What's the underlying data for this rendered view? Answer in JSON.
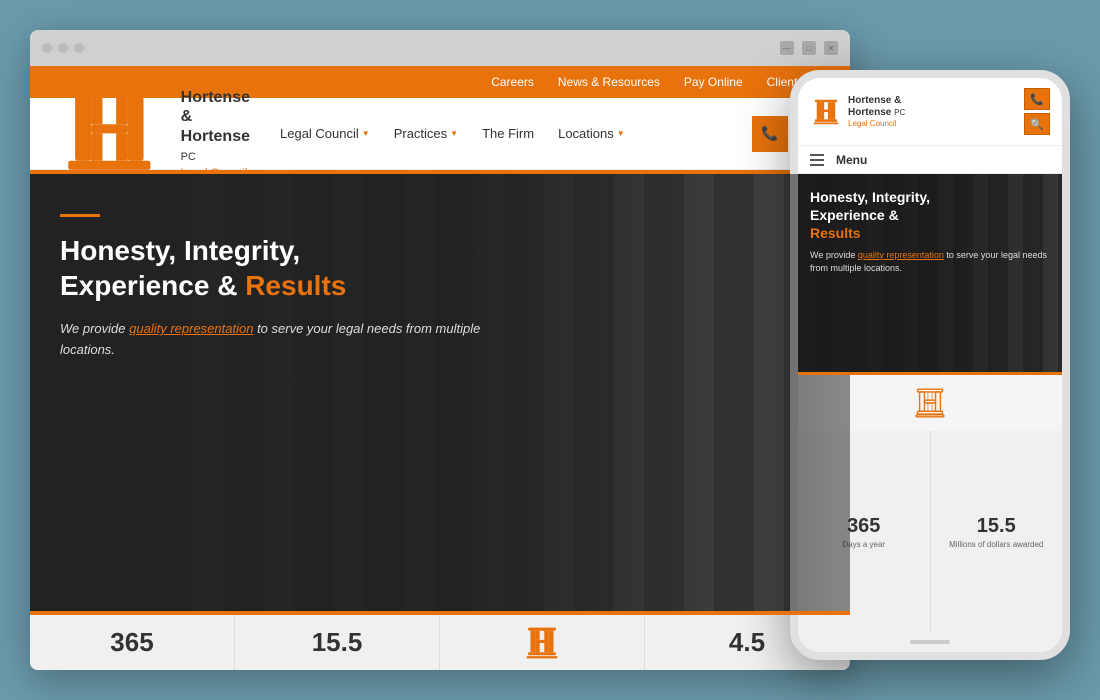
{
  "colors": {
    "accent": "#e8720c",
    "dark": "#2a2a2a",
    "light_bg": "#f0f0f0"
  },
  "desktop": {
    "utility_bar": {
      "links": [
        "Careers",
        "News & Resources",
        "Pay Online",
        "Client Login"
      ]
    },
    "nav": {
      "logo_name": "Hortense &\nHortense PC",
      "logo_tagline": "Legal Council",
      "links": [
        {
          "label": "Legal Council",
          "has_arrow": true
        },
        {
          "label": "Practices",
          "has_arrow": true
        },
        {
          "label": "The Firm",
          "has_arrow": false
        },
        {
          "label": "Locations",
          "has_arrow": true
        }
      ]
    },
    "hero": {
      "title_part1": "Honesty, Integrity,",
      "title_part2": "Experience &",
      "title_highlight": "Results",
      "subtitle_before": "We provide ",
      "subtitle_link": "quality representation",
      "subtitle_after": " to serve your legal needs from multiple locations."
    },
    "stats": [
      {
        "number": "365",
        "label": ""
      },
      {
        "number": "15.5",
        "label": ""
      },
      {
        "number": "",
        "label": ""
      },
      {
        "number": "4.5",
        "label": ""
      }
    ]
  },
  "mobile": {
    "logo_name": "Hortense &\nHortense PC",
    "logo_tagline": "Legal Council",
    "menu_label": "Menu",
    "hero": {
      "title_part1": "Honesty, Integrity,",
      "title_part2": "Experience &",
      "title_highlight": "Results",
      "subtitle_before": "We provide ",
      "subtitle_link": "quality representation",
      "subtitle_after": " to serve your legal needs from multiple locations."
    },
    "stats": [
      {
        "number": "365",
        "label": "Days a year"
      },
      {
        "number": "15.5",
        "label": "Millions of dollars awarded"
      }
    ]
  }
}
